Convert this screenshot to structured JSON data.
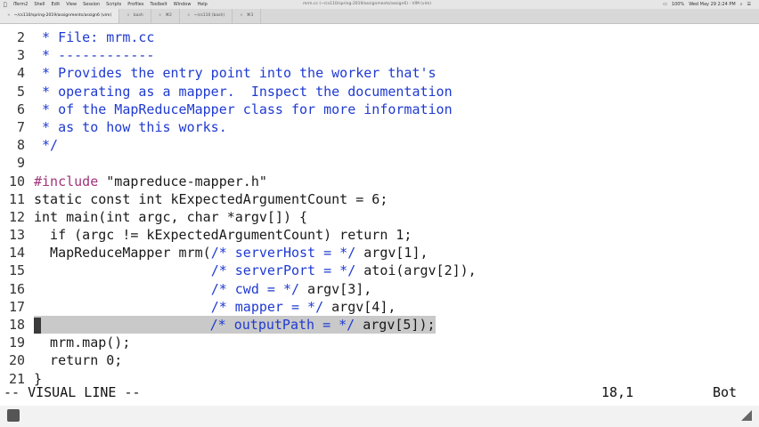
{
  "menubar": {
    "apple": "",
    "menus": [
      "iTerm2",
      "Shell",
      "Edit",
      "View",
      "Session",
      "Scripts",
      "Profiles",
      "Toolbelt",
      "Window",
      "Help"
    ],
    "window_title": "mrm.cc (~/cs110/spring-2019/assignments/assign6) - VIM (vim)",
    "status": {
      "battery": "100%",
      "datetime": "Wed May 29  2:24 PM"
    }
  },
  "tabs": [
    {
      "label": "~/cs110/spring-2019/assignments/assign6 (vim)",
      "active": true
    },
    {
      "label": "bash",
      "active": false
    },
    {
      "label": "⌘2",
      "active": false
    },
    {
      "label": "~/cs110 (bash)",
      "active": false
    },
    {
      "label": "⌘3",
      "active": false
    }
  ],
  "editor": {
    "lines": [
      {
        "num": "2",
        "segments": [
          {
            "cls": "cm",
            "text": " * File: mrm.cc"
          }
        ]
      },
      {
        "num": "3",
        "segments": [
          {
            "cls": "cm",
            "text": " * ------------"
          }
        ]
      },
      {
        "num": "4",
        "segments": [
          {
            "cls": "cm",
            "text": " * Provides the entry point into the worker that's"
          }
        ]
      },
      {
        "num": "5",
        "segments": [
          {
            "cls": "cm",
            "text": " * operating as a mapper.  Inspect the documentation"
          }
        ]
      },
      {
        "num": "6",
        "segments": [
          {
            "cls": "cm",
            "text": " * of the MapReduceMapper class for more information"
          }
        ]
      },
      {
        "num": "7",
        "segments": [
          {
            "cls": "cm",
            "text": " * as to how this works."
          }
        ]
      },
      {
        "num": "8",
        "segments": [
          {
            "cls": "cm",
            "text": " */"
          }
        ]
      },
      {
        "num": "9",
        "segments": []
      },
      {
        "num": "10",
        "segments": [
          {
            "cls": "pp",
            "text": "#include"
          },
          {
            "cls": "",
            "text": " \"mapreduce-mapper.h\""
          }
        ]
      },
      {
        "num": "11",
        "segments": [
          {
            "cls": "",
            "text": "static const int kExpectedArgumentCount = 6;"
          }
        ]
      },
      {
        "num": "12",
        "segments": [
          {
            "cls": "",
            "text": "int main(int argc, char *argv[]) {"
          }
        ]
      },
      {
        "num": "13",
        "segments": [
          {
            "cls": "",
            "text": "  if (argc != kExpectedArgumentCount) return 1;"
          }
        ]
      },
      {
        "num": "14",
        "segments": [
          {
            "cls": "",
            "text": "  MapReduceMapper mrm("
          },
          {
            "cls": "cm",
            "text": "/* serverHost = */"
          },
          {
            "cls": "",
            "text": " argv[1],"
          }
        ]
      },
      {
        "num": "15",
        "segments": [
          {
            "cls": "",
            "text": "                      "
          },
          {
            "cls": "cm",
            "text": "/* serverPort = */"
          },
          {
            "cls": "",
            "text": " atoi(argv[2]),"
          }
        ]
      },
      {
        "num": "16",
        "segments": [
          {
            "cls": "",
            "text": "                      "
          },
          {
            "cls": "cm",
            "text": "/* cwd = */"
          },
          {
            "cls": "",
            "text": " argv[3],"
          }
        ]
      },
      {
        "num": "17",
        "segments": [
          {
            "cls": "",
            "text": "                      "
          },
          {
            "cls": "cm",
            "text": "/* mapper = */"
          },
          {
            "cls": "",
            "text": " argv[4],"
          }
        ]
      },
      {
        "num": "18",
        "selected": true,
        "segments": [
          {
            "cls": "",
            "text": "                      "
          },
          {
            "cls": "cm",
            "text": "/* outputPath = */"
          },
          {
            "cls": "",
            "text": " argv[5]);"
          }
        ]
      },
      {
        "num": "19",
        "segments": [
          {
            "cls": "",
            "text": "  mrm.map();"
          }
        ]
      },
      {
        "num": "20",
        "segments": [
          {
            "cls": "",
            "text": "  return 0;"
          }
        ]
      },
      {
        "num": "21",
        "segments": [
          {
            "cls": "",
            "text": "}"
          }
        ]
      }
    ]
  },
  "statusline": {
    "mode": "-- VISUAL LINE --",
    "position": "18,1",
    "scroll": "Bot"
  },
  "colors": {
    "comment": "#1f3ad1",
    "preprocessor": "#a0347a",
    "selection": "#c9c9c9"
  }
}
